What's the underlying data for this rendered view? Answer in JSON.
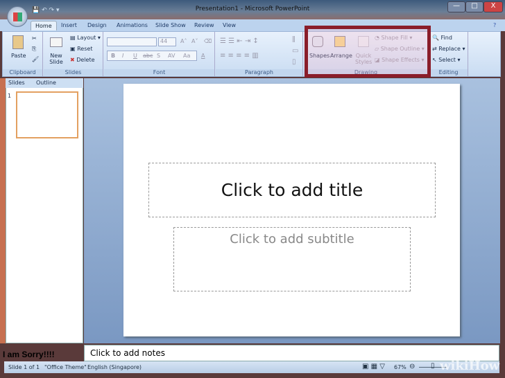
{
  "window": {
    "title": "Presentation1 - Microsoft PowerPoint",
    "minimize": "—",
    "maximize": "□",
    "close": "X"
  },
  "qat": {
    "save": "💾",
    "undo": "↶",
    "redo": "↷",
    "customize": "▾"
  },
  "tabs": [
    "Home",
    "Insert",
    "Design",
    "Animations",
    "Slide Show",
    "Review",
    "View"
  ],
  "ribbon": {
    "clipboard": {
      "label": "Clipboard",
      "paste": "Paste"
    },
    "slides": {
      "label": "Slides",
      "new_slide": "New Slide",
      "layout": "Layout",
      "reset": "Reset",
      "delete": "Delete"
    },
    "font": {
      "label": "Font",
      "size": "44",
      "bold": "B",
      "italic": "I",
      "underline": "U",
      "strike": "abc",
      "shadow": "S",
      "spacing": "AV",
      "case": "Aa",
      "color": "A",
      "grow": "A˄",
      "shrink": "A˅"
    },
    "paragraph": {
      "label": "Paragraph"
    },
    "drawing": {
      "label": "Drawing",
      "shapes": "Shapes",
      "arrange": "Arrange",
      "quick_styles": "Quick Styles",
      "shape_fill": "Shape Fill",
      "shape_outline": "Shape Outline",
      "shape_effects": "Shape Effects"
    },
    "editing": {
      "label": "Editing",
      "find": "Find",
      "replace": "Replace",
      "select": "Select"
    }
  },
  "pane": {
    "tabs": [
      "Slides",
      "Outline"
    ],
    "slide_number": "1"
  },
  "slide": {
    "title_placeholder": "Click to add title",
    "subtitle_placeholder": "Click to add subtitle"
  },
  "notes": {
    "placeholder": "Click to add notes"
  },
  "overlay_text": "I am Sorry!!!!",
  "status": {
    "slide": "Slide 1 of 1",
    "theme": "\"Office Theme\"",
    "language": "English (Singapore)",
    "zoom": "67%"
  },
  "watermark": "wikiHow",
  "colors": {
    "highlight": "#8a1d2a",
    "ribbon": "#c9dcf2"
  }
}
